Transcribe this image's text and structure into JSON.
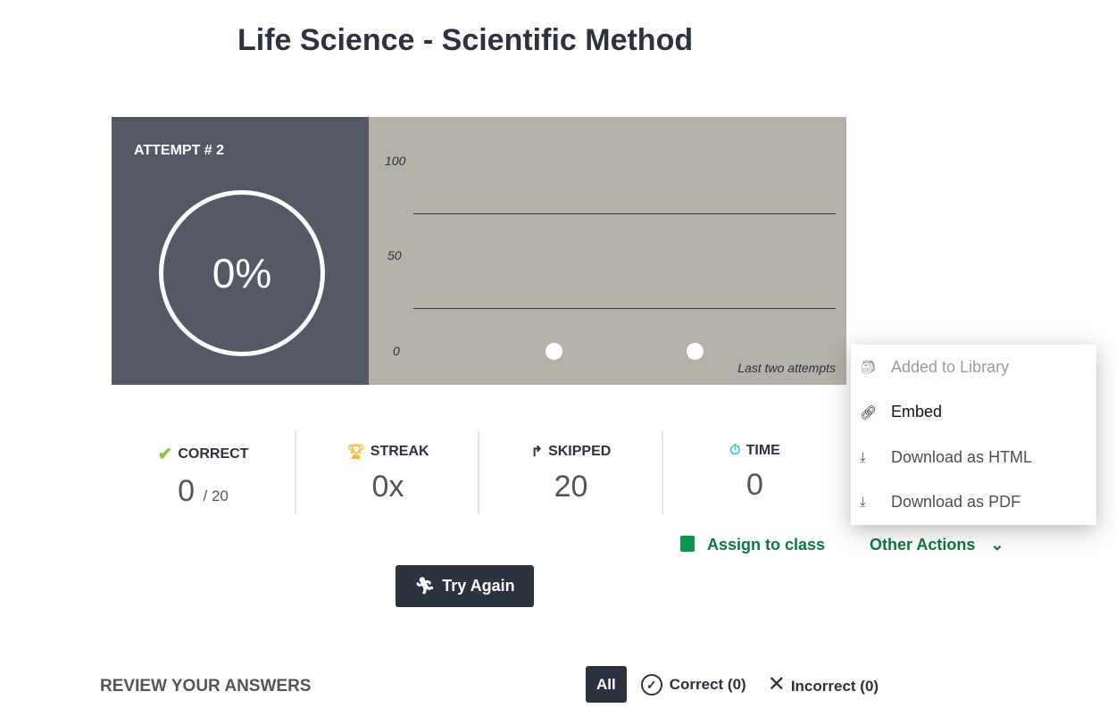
{
  "title": "Life Science - Scientific Method",
  "score": {
    "attempt_label": "ATTEMPT # 2",
    "percent": "0%"
  },
  "chart_data": {
    "type": "scatter",
    "x": [
      "Attempt 1",
      "Attempt 2"
    ],
    "values": [
      0,
      0
    ],
    "yticks": [
      "100",
      "50",
      "0"
    ],
    "ylim": [
      0,
      100
    ],
    "caption": "Last two attempts",
    "colors": {
      "background": "#b5b0a9",
      "point": "#ffffff"
    }
  },
  "stats": [
    {
      "label": "CORRECT",
      "value": "0",
      "suffix": "/ 20",
      "icon": "check-icon",
      "color": "#8dc63f"
    },
    {
      "label": "STREAK",
      "value": "0x",
      "icon": "trophy-icon",
      "color": "#f5b921"
    },
    {
      "label": "SKIPPED",
      "value": "20",
      "icon": "skip-arrow-icon",
      "color": "#2d3240"
    },
    {
      "label": "TIME",
      "value": "0",
      "icon": "stopwatch-icon",
      "color": "#3cc5c9"
    }
  ],
  "actions": {
    "assign": "Assign to class",
    "other": "Other Actions",
    "try_again": "Try Again"
  },
  "menu": [
    "Added to Library",
    "Embed",
    "Download as HTML",
    "Download as PDF"
  ],
  "review": {
    "heading": "REVIEW YOUR ANSWERS",
    "all": "All",
    "correct": "Correct (0)",
    "incorrect": "Incorrect (0)"
  }
}
